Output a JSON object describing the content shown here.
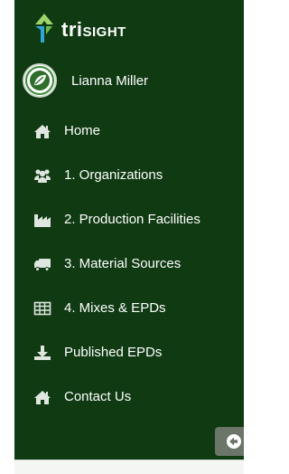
{
  "brand": {
    "name_prefix": "tri",
    "name_suffix": "SIGHT",
    "logo_icon": "arrow-up-down-icon",
    "colors": {
      "arrow_up": "#9fd46b",
      "arrow_down": "#2fa6d6"
    }
  },
  "user": {
    "name": "Lianna Miller",
    "avatar_icon": "leaf-badge-icon"
  },
  "nav": {
    "items": [
      {
        "label": "Home",
        "icon": "home-icon"
      },
      {
        "label": "1. Organizations",
        "icon": "users-icon"
      },
      {
        "label": "2. Production Facilities",
        "icon": "factory-icon"
      },
      {
        "label": "3. Material Sources",
        "icon": "truck-icon"
      },
      {
        "label": "4. Mixes & EPDs",
        "icon": "table-icon"
      },
      {
        "label": "Published EPDs",
        "icon": "download-icon"
      },
      {
        "label": "Contact Us",
        "icon": "home-icon"
      }
    ]
  },
  "collapse_button": {
    "icon": "circle-arrow-left-icon"
  },
  "colors": {
    "sidebar_bg": "#0f3a12",
    "text": "#ffffff",
    "icon": "#dfe6df",
    "collapse_bg": "#6b7568"
  }
}
